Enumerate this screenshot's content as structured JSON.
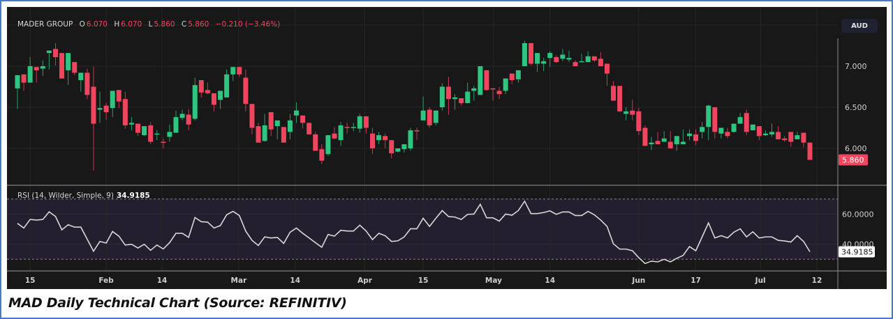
{
  "header": {
    "symbol": "MADER GROUP",
    "o_label": "O",
    "o": "6.070",
    "h_label": "H",
    "h": "6.070",
    "l_label": "L",
    "l": "5.860",
    "c_label": "C",
    "c": "5.860",
    "change": "−0.210 (−3.46%)"
  },
  "currency": "AUD",
  "caption": "MAD Daily Technical Chart (Source: REFINITIV)",
  "colors": {
    "up": "#2fc480",
    "down": "#f0455f",
    "background": "#181818",
    "rsi_band": "#241f2e",
    "rsi_line": "#d8d8d8"
  },
  "chart_data": [
    {
      "type": "candlestick",
      "title": "MADER GROUP",
      "price_axis": {
        "ticks": [
          "7.000",
          "6.500",
          "6.000"
        ],
        "tick_values": [
          7.0,
          6.5,
          6.0
        ],
        "range": [
          5.55,
          7.72
        ]
      },
      "last_price_label": "5.860",
      "x_ticks": [
        {
          "label": "15",
          "index": 2
        },
        {
          "label": "Feb",
          "index": 14
        },
        {
          "label": "14",
          "index": 22.8
        },
        {
          "label": "Mar",
          "index": 34.9
        },
        {
          "label": "14",
          "index": 43.8
        },
        {
          "label": "Apr",
          "index": 54.8
        },
        {
          "label": "15",
          "index": 64
        },
        {
          "label": "May",
          "index": 75.1
        },
        {
          "label": "14",
          "index": 84
        },
        {
          "label": "Jun",
          "index": 98
        },
        {
          "label": "17",
          "index": 107
        },
        {
          "label": "Jul",
          "index": 117.2
        },
        {
          "label": "12",
          "index": 126.1
        }
      ],
      "ohlc": [
        [
          6.73,
          6.89,
          6.48,
          6.89
        ],
        [
          6.9,
          6.9,
          6.7,
          6.8
        ],
        [
          6.8,
          7.11,
          6.8,
          7.0
        ],
        [
          6.99,
          6.99,
          6.8,
          6.95
        ],
        [
          6.97,
          7.07,
          6.88,
          7.0
        ],
        [
          7.16,
          7.19,
          6.96,
          7.19
        ],
        [
          7.21,
          7.28,
          7.01,
          7.11
        ],
        [
          7.16,
          7.16,
          6.85,
          6.85
        ],
        [
          6.95,
          7.16,
          6.77,
          7.16
        ],
        [
          7.05,
          7.05,
          6.89,
          6.92
        ],
        [
          6.83,
          6.92,
          6.69,
          6.92
        ],
        [
          6.92,
          6.97,
          6.6,
          6.65
        ],
        [
          6.75,
          6.99,
          5.73,
          6.3
        ],
        [
          6.47,
          6.69,
          6.31,
          6.49
        ],
        [
          6.52,
          6.55,
          6.35,
          6.44
        ],
        [
          6.49,
          6.7,
          6.38,
          6.7
        ],
        [
          6.71,
          6.71,
          6.49,
          6.57
        ],
        [
          6.6,
          6.69,
          6.24,
          6.28
        ],
        [
          6.29,
          6.38,
          6.22,
          6.31
        ],
        [
          6.3,
          6.3,
          6.15,
          6.19
        ],
        [
          6.16,
          6.27,
          6.15,
          6.27
        ],
        [
          6.28,
          6.32,
          6.05,
          6.08
        ],
        [
          6.17,
          6.22,
          6.1,
          6.18
        ],
        [
          6.08,
          6.12,
          6.0,
          6.07
        ],
        [
          6.14,
          6.29,
          6.08,
          6.2
        ],
        [
          6.19,
          6.46,
          6.19,
          6.38
        ],
        [
          6.37,
          6.47,
          6.34,
          6.42
        ],
        [
          6.41,
          6.48,
          6.22,
          6.29
        ],
        [
          6.36,
          6.86,
          6.34,
          6.77
        ],
        [
          6.83,
          6.83,
          6.62,
          6.68
        ],
        [
          6.71,
          6.8,
          6.66,
          6.67
        ],
        [
          6.67,
          6.67,
          6.45,
          6.53
        ],
        [
          6.59,
          6.7,
          6.48,
          6.7
        ],
        [
          6.62,
          6.96,
          6.62,
          6.9
        ],
        [
          6.9,
          6.99,
          6.82,
          6.99
        ],
        [
          6.99,
          6.99,
          6.87,
          6.9
        ],
        [
          6.86,
          6.96,
          6.45,
          6.54
        ],
        [
          6.54,
          6.54,
          6.17,
          6.25
        ],
        [
          6.27,
          6.31,
          6.07,
          6.07
        ],
        [
          6.09,
          6.42,
          6.08,
          6.28
        ],
        [
          6.44,
          6.44,
          6.15,
          6.23
        ],
        [
          6.27,
          6.34,
          6.11,
          6.34
        ],
        [
          6.26,
          6.26,
          6.07,
          6.07
        ],
        [
          6.2,
          6.42,
          6.11,
          6.34
        ],
        [
          6.4,
          6.56,
          6.31,
          6.46
        ],
        [
          6.4,
          6.4,
          6.24,
          6.31
        ],
        [
          6.31,
          6.31,
          6.17,
          6.17
        ],
        [
          6.17,
          6.2,
          5.97,
          5.97
        ],
        [
          5.99,
          6.05,
          5.81,
          5.85
        ],
        [
          5.93,
          6.16,
          5.91,
          6.16
        ],
        [
          6.18,
          6.26,
          6.11,
          6.12
        ],
        [
          6.1,
          6.32,
          6.03,
          6.28
        ],
        [
          6.26,
          6.31,
          6.18,
          6.25
        ],
        [
          6.25,
          6.31,
          6.21,
          6.26
        ],
        [
          6.24,
          6.42,
          6.19,
          6.39
        ],
        [
          6.39,
          6.39,
          6.18,
          6.25
        ],
        [
          6.18,
          6.25,
          5.93,
          6.0
        ],
        [
          6.1,
          6.2,
          6.05,
          6.16
        ],
        [
          6.15,
          6.18,
          6.0,
          6.1
        ],
        [
          6.1,
          6.1,
          5.88,
          5.94
        ],
        [
          5.96,
          6.0,
          5.95,
          6.0
        ],
        [
          5.99,
          6.05,
          5.95,
          6.05
        ],
        [
          6.0,
          6.25,
          5.97,
          6.22
        ],
        [
          6.22,
          6.25,
          6.1,
          6.21
        ],
        [
          6.34,
          6.63,
          6.34,
          6.46
        ],
        [
          6.47,
          6.5,
          6.25,
          6.28
        ],
        [
          6.31,
          6.46,
          6.28,
          6.46
        ],
        [
          6.5,
          6.79,
          6.46,
          6.75
        ],
        [
          6.75,
          6.87,
          6.41,
          6.6
        ],
        [
          6.6,
          6.66,
          6.47,
          6.62
        ],
        [
          6.61,
          6.61,
          6.52,
          6.55
        ],
        [
          6.55,
          6.8,
          6.55,
          6.69
        ],
        [
          6.7,
          6.76,
          6.58,
          6.73
        ],
        [
          6.65,
          7.0,
          6.65,
          7.0
        ],
        [
          6.95,
          6.95,
          6.7,
          6.71
        ],
        [
          6.73,
          6.73,
          6.58,
          6.72
        ],
        [
          6.7,
          6.75,
          6.6,
          6.66
        ],
        [
          6.7,
          6.85,
          6.66,
          6.85
        ],
        [
          6.91,
          6.91,
          6.78,
          6.83
        ],
        [
          6.84,
          6.95,
          6.8,
          6.95
        ],
        [
          7.0,
          7.31,
          7.0,
          7.28
        ],
        [
          7.28,
          7.28,
          7.01,
          7.03
        ],
        [
          7.03,
          7.16,
          6.93,
          7.16
        ],
        [
          7.03,
          7.1,
          6.94,
          7.06
        ],
        [
          7.1,
          7.18,
          6.99,
          7.16
        ],
        [
          7.11,
          7.13,
          7.04,
          7.05
        ],
        [
          7.09,
          7.21,
          7.06,
          7.14
        ],
        [
          7.08,
          7.19,
          7.05,
          7.1
        ],
        [
          7.05,
          7.07,
          7.0,
          7.0
        ],
        [
          7.05,
          7.15,
          7.05,
          7.06
        ],
        [
          7.05,
          7.18,
          7.05,
          7.12
        ],
        [
          7.12,
          7.12,
          7.05,
          7.07
        ],
        [
          7.09,
          7.17,
          7.0,
          7.0
        ],
        [
          7.03,
          7.03,
          6.76,
          6.91
        ],
        [
          6.76,
          6.82,
          6.58,
          6.58
        ],
        [
          6.76,
          6.76,
          6.44,
          6.45
        ],
        [
          6.42,
          6.5,
          6.34,
          6.45
        ],
        [
          6.46,
          6.59,
          6.34,
          6.41
        ],
        [
          6.45,
          6.49,
          6.16,
          6.21
        ],
        [
          6.25,
          6.28,
          6.03,
          6.03
        ],
        [
          6.05,
          6.14,
          5.98,
          6.07
        ],
        [
          6.09,
          6.2,
          6.05,
          6.05
        ],
        [
          6.08,
          6.21,
          6.08,
          6.12
        ],
        [
          6.08,
          6.21,
          6.0,
          6.0
        ],
        [
          6.05,
          6.15,
          5.97,
          6.15
        ],
        [
          6.05,
          6.23,
          6.05,
          6.08
        ],
        [
          6.15,
          6.23,
          6.1,
          6.18
        ],
        [
          6.17,
          6.23,
          6.04,
          6.09
        ],
        [
          6.2,
          6.32,
          6.12,
          6.26
        ],
        [
          6.26,
          6.53,
          6.1,
          6.52
        ],
        [
          6.5,
          6.5,
          6.12,
          6.2
        ],
        [
          6.18,
          6.25,
          6.12,
          6.25
        ],
        [
          6.2,
          6.25,
          6.12,
          6.15
        ],
        [
          6.2,
          6.3,
          6.19,
          6.3
        ],
        [
          6.3,
          6.43,
          6.3,
          6.38
        ],
        [
          6.43,
          6.47,
          6.16,
          6.2
        ],
        [
          6.22,
          6.29,
          6.22,
          6.29
        ],
        [
          6.27,
          6.27,
          6.1,
          6.15
        ],
        [
          6.16,
          6.22,
          6.15,
          6.18
        ],
        [
          6.17,
          6.3,
          6.14,
          6.2
        ],
        [
          6.2,
          6.27,
          6.11,
          6.11
        ],
        [
          6.12,
          6.15,
          6.08,
          6.1
        ],
        [
          6.2,
          6.2,
          6.02,
          6.08
        ],
        [
          6.11,
          6.2,
          6.11,
          6.16
        ],
        [
          6.19,
          6.19,
          6.01,
          6.07
        ],
        [
          6.07,
          6.07,
          5.86,
          5.86
        ]
      ]
    },
    {
      "type": "line",
      "title": "RSI (14, Wilder, Simple, 9)",
      "last_value": "34.9185",
      "y_ticks": [
        "60.0000",
        "40.0000"
      ],
      "y_tick_values": [
        60,
        40
      ],
      "band": [
        30,
        70
      ],
      "values": [
        53.8,
        50.7,
        56.4,
        56,
        56.4,
        61.5,
        58.4,
        49.5,
        52.9,
        51.3,
        51.3,
        43.3,
        35.3,
        41.8,
        40.7,
        48.4,
        45.3,
        39.4,
        39.9,
        37.4,
        39.9,
        35.9,
        39.4,
        36.8,
        41,
        47.2,
        47.2,
        44.5,
        57.7,
        54.9,
        54.6,
        50.7,
        52.3,
        59.5,
        61.8,
        59,
        48.7,
        42.5,
        39.1,
        44.8,
        44.1,
        44.5,
        40.5,
        47.9,
        50.7,
        47.2,
        44.1,
        41,
        37.9,
        46.4,
        45.3,
        49.2,
        48.7,
        48.7,
        52.6,
        48.7,
        43,
        47.2,
        45.6,
        41.8,
        42.2,
        44.8,
        50.2,
        50.2,
        57.2,
        51.8,
        57.2,
        62.3,
        58.3,
        58,
        56.4,
        59.8,
        60,
        66.5,
        57.5,
        57.5,
        55.3,
        60,
        59.2,
        62.3,
        68.5,
        60.3,
        60.3,
        61,
        62.1,
        59.8,
        61.4,
        61.4,
        59,
        59,
        61.8,
        59.5,
        56,
        51.8,
        40.2,
        36.7,
        36.7,
        35.6,
        31,
        27.1,
        28.7,
        28.2,
        29.9,
        28.2,
        30.6,
        32.5,
        38.4,
        35.6,
        44.8,
        54.1,
        44.1,
        45.6,
        44.1,
        47.9,
        50.2,
        44.8,
        48.2,
        44.1,
        44.8,
        44.8,
        42.5,
        42.1,
        41.4,
        45.6,
        41.8,
        34.9
      ]
    }
  ]
}
